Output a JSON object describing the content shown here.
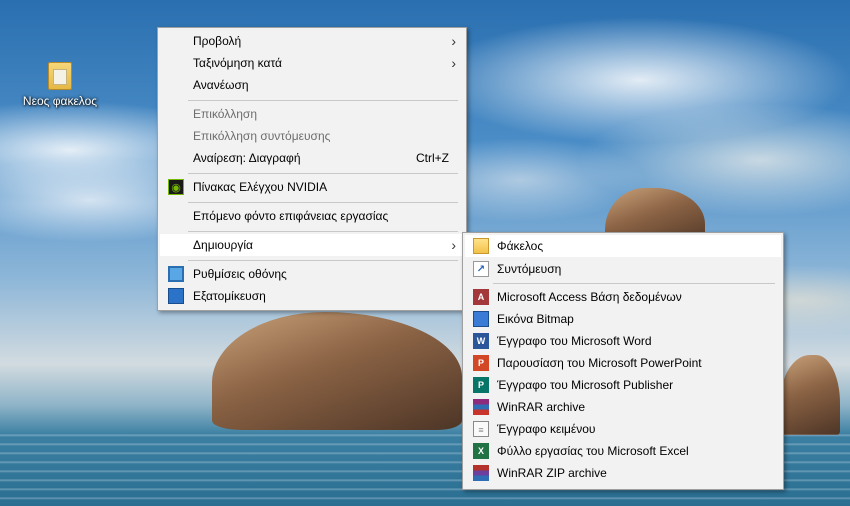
{
  "desktop": {
    "icon_label": "Νεος φακελος",
    "icon_name": "folder-icon"
  },
  "context_menu": {
    "items": [
      {
        "label": "Προβολή",
        "has_submenu": true,
        "enabled": true
      },
      {
        "label": "Ταξινόμηση κατά",
        "has_submenu": true,
        "enabled": true
      },
      {
        "label": "Ανανέωση",
        "enabled": true
      },
      {
        "label": "Επικόλληση",
        "enabled": false
      },
      {
        "label": "Επικόλληση συντόμευσης",
        "enabled": false
      },
      {
        "label": "Αναίρεση: Διαγραφή",
        "shortcut": "Ctrl+Z",
        "enabled": true
      },
      {
        "label": "Πίνακας Ελέγχου NVIDIA",
        "icon": "nvidia-icon",
        "enabled": true
      },
      {
        "label": "Επόμενο φόντο επιφάνειας εργασίας",
        "enabled": true
      },
      {
        "label": "Δημιουργία",
        "has_submenu": true,
        "highlighted": true,
        "enabled": true
      },
      {
        "label": "Ρυθμίσεις οθόνης",
        "icon": "display-settings-icon",
        "enabled": true
      },
      {
        "label": "Εξατομίκευση",
        "icon": "personalize-icon",
        "enabled": true
      }
    ],
    "arrow_glyph": "›"
  },
  "new_submenu": {
    "items": [
      {
        "label": "Φάκελος",
        "icon": "folder-icon",
        "highlighted": true
      },
      {
        "label": "Συντόμευση",
        "icon": "shortcut-icon"
      },
      {
        "label": "Microsoft Access Βάση δεδομένων",
        "icon": "access-icon",
        "glyph": "A"
      },
      {
        "label": "Εικόνα Bitmap",
        "icon": "bitmap-icon"
      },
      {
        "label": "Έγγραφο του Microsoft Word",
        "icon": "word-icon",
        "glyph": "W"
      },
      {
        "label": "Παρουσίαση του Microsoft PowerPoint",
        "icon": "powerpoint-icon",
        "glyph": "P"
      },
      {
        "label": "Έγγραφο του Microsoft Publisher",
        "icon": "publisher-icon",
        "glyph": "P"
      },
      {
        "label": "WinRAR archive",
        "icon": "winrar-icon"
      },
      {
        "label": "Έγγραφο κειμένου",
        "icon": "text-document-icon",
        "glyph": "≡"
      },
      {
        "label": "Φύλλο εργασίας του Microsoft Excel",
        "icon": "excel-icon",
        "glyph": "X"
      },
      {
        "label": "WinRAR ZIP archive",
        "icon": "winrar-zip-icon"
      }
    ]
  },
  "colors": {
    "menu_bg": "#f2f2f2",
    "highlight_bg": "#ffffff",
    "disabled_text": "#6d6d6d"
  }
}
